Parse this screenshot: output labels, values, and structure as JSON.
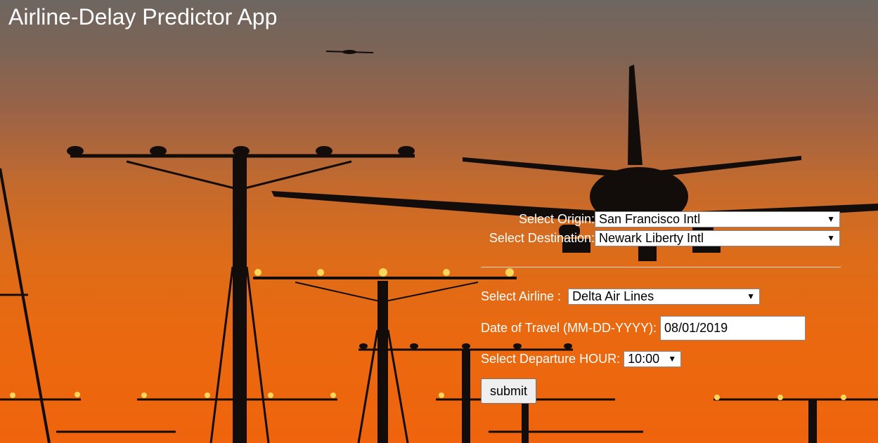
{
  "app": {
    "title": "Airline-Delay Predictor App"
  },
  "form": {
    "origin": {
      "label": "Select Origin:",
      "selected": "San Francisco Intl"
    },
    "destination": {
      "label": "Select Destination:",
      "selected": "Newark Liberty Intl"
    },
    "airline": {
      "label": "Select Airline :",
      "selected": "Delta Air Lines"
    },
    "date": {
      "label": "Date of Travel (MM-DD-YYYY):",
      "value": "08/01/2019"
    },
    "hour": {
      "label": "Select Departure HOUR:",
      "selected": "10:00"
    },
    "submit_label": "submit"
  },
  "icons": {
    "dropdown_arrow": "▼"
  },
  "colors": {
    "sky_top": "#6e6661",
    "sky_bottom": "#ef640c",
    "silhouette": "#120d0b",
    "lights": "#ffd65a"
  }
}
